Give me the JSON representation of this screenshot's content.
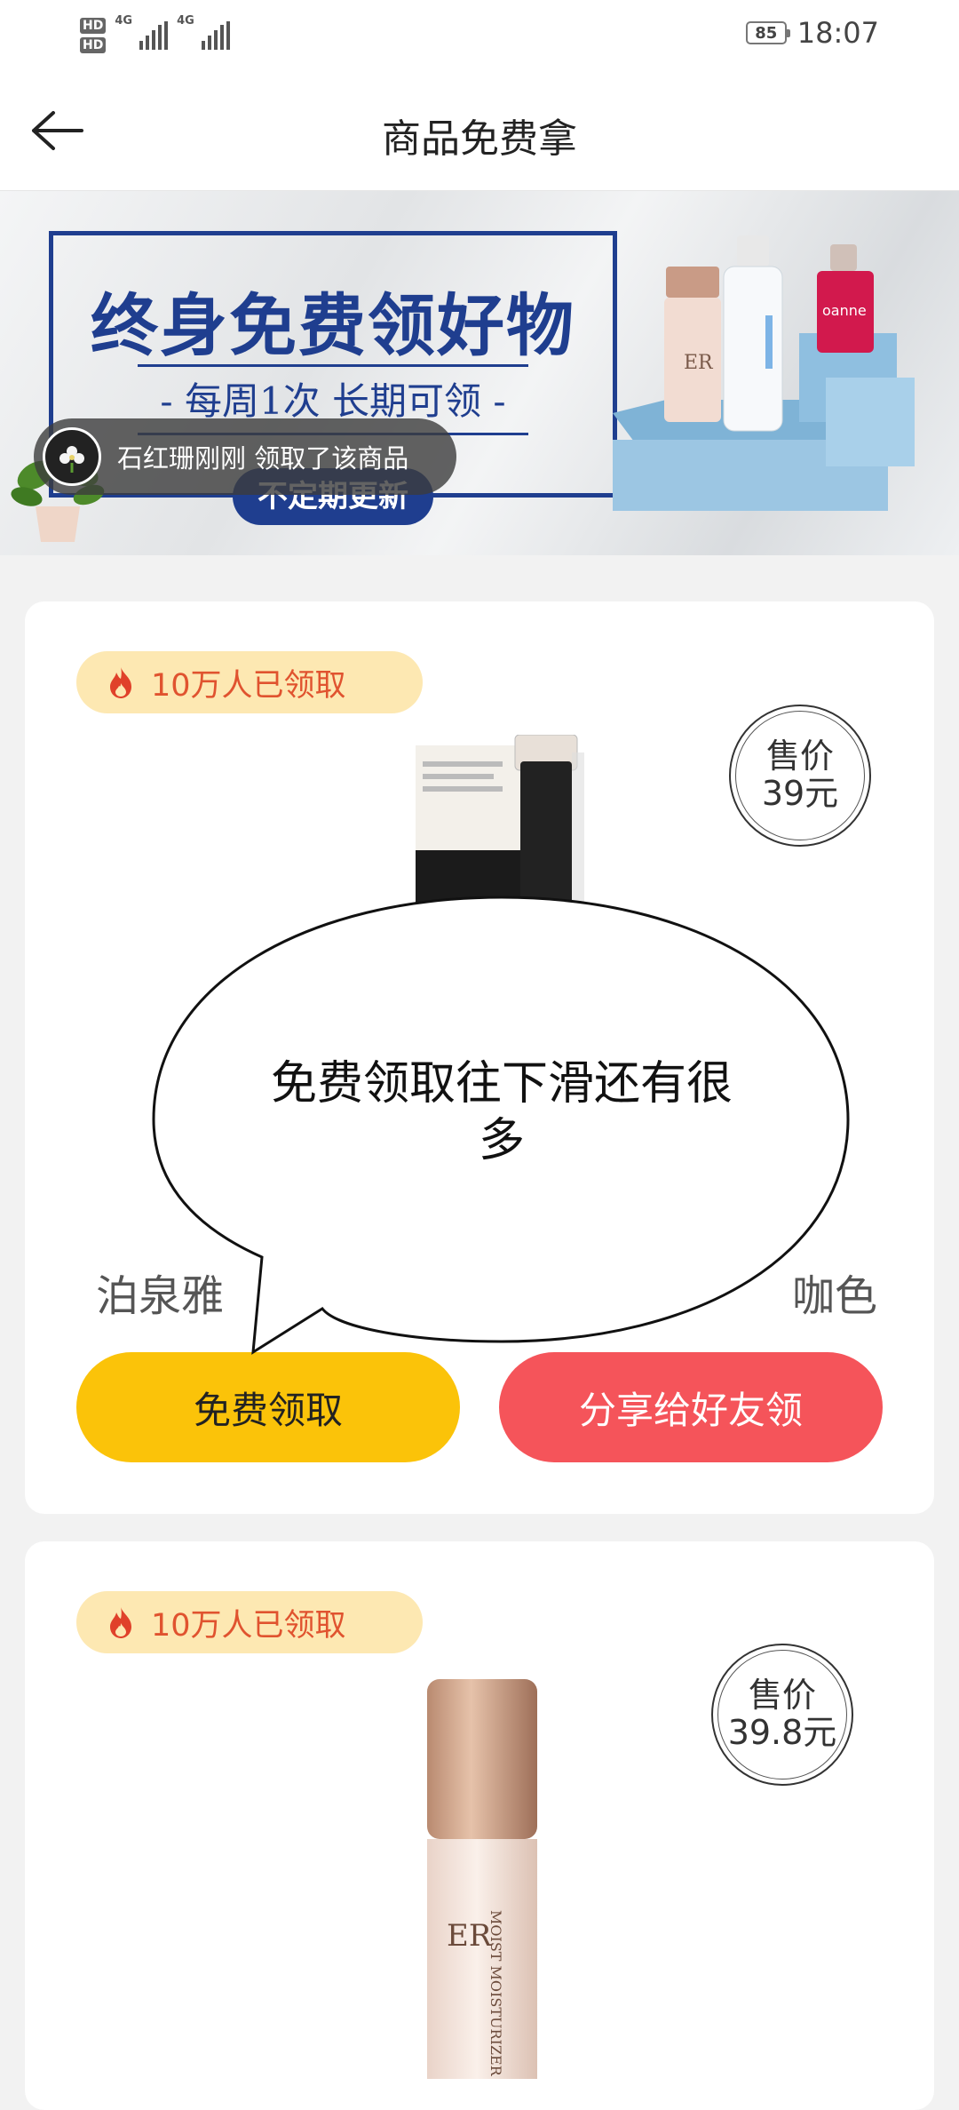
{
  "status_bar": {
    "sim1": "HD",
    "sim2": "HD",
    "network1": "4G",
    "network2": "4G",
    "battery": "85",
    "time": "18:07"
  },
  "header": {
    "title": "商品免费拿",
    "back_icon": "arrow-left-icon"
  },
  "banner": {
    "headline": "终身免费领好物",
    "subline": "- 每周1次 长期可领 -",
    "badge": "不定期更新"
  },
  "toast": {
    "text": "石红珊刚刚 领取了该商品"
  },
  "products": [
    {
      "claimed": "10万人已领取",
      "price_label": "售价",
      "price_value": "39元",
      "name_start": "泊泉雅",
      "name_end": "咖色",
      "free_button": "免费领取",
      "share_button": "分享给好友领"
    },
    {
      "claimed": "10万人已领取",
      "price_label": "售价",
      "price_value": "39.8元"
    }
  ],
  "overlay": {
    "bubble_text": "免费领取往下滑还有很多"
  },
  "colors": {
    "accent_yellow": "#fbc309",
    "accent_red": "#f5545a",
    "banner_blue": "#1f3e8f",
    "badge_bg": "#fde8b2",
    "badge_text": "#e0532f"
  }
}
